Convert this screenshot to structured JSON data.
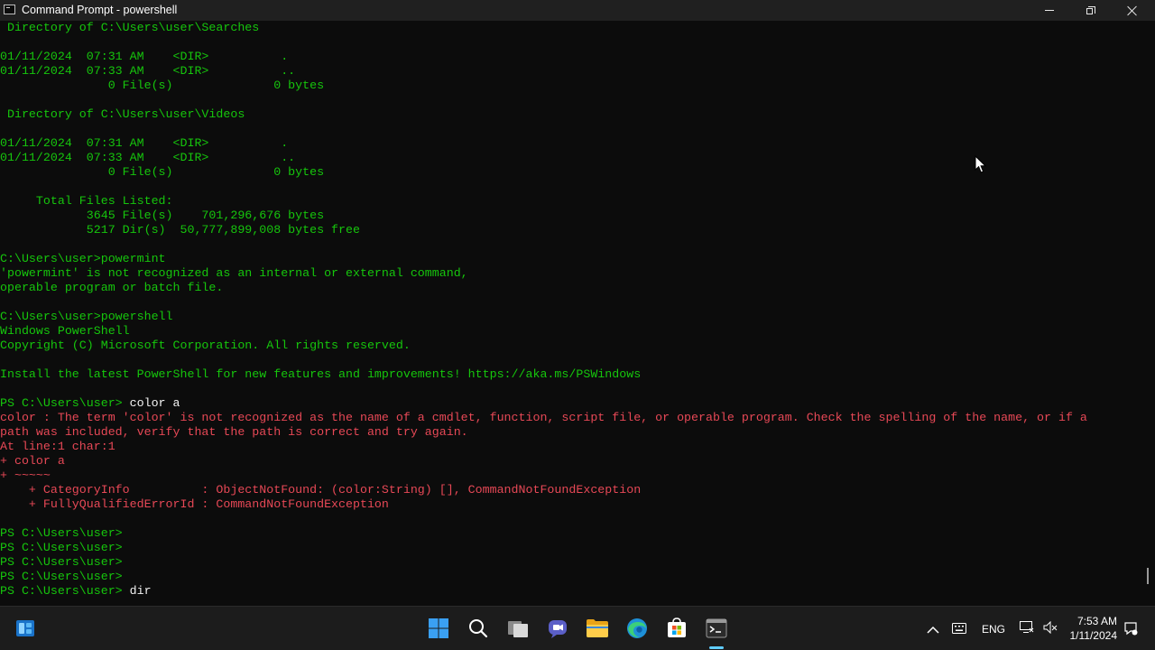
{
  "window": {
    "title": "Command Prompt - powershell",
    "controls": {
      "minimize": "minimize",
      "maximize": "restore",
      "close": "close"
    }
  },
  "terminal": {
    "lines": [
      {
        "text": " Directory of C:\\Users\\user\\Searches",
        "style": "green"
      },
      {
        "text": "",
        "style": "green"
      },
      {
        "text": "01/11/2024  07:31 AM    <DIR>          .",
        "style": "green"
      },
      {
        "text": "01/11/2024  07:33 AM    <DIR>          ..",
        "style": "green"
      },
      {
        "text": "               0 File(s)              0 bytes",
        "style": "green"
      },
      {
        "text": "",
        "style": "green"
      },
      {
        "text": " Directory of C:\\Users\\user\\Videos",
        "style": "green"
      },
      {
        "text": "",
        "style": "green"
      },
      {
        "text": "01/11/2024  07:31 AM    <DIR>          .",
        "style": "green"
      },
      {
        "text": "01/11/2024  07:33 AM    <DIR>          ..",
        "style": "green"
      },
      {
        "text": "               0 File(s)              0 bytes",
        "style": "green"
      },
      {
        "text": "",
        "style": "green"
      },
      {
        "text": "     Total Files Listed:",
        "style": "green"
      },
      {
        "text": "            3645 File(s)    701,296,676 bytes",
        "style": "green"
      },
      {
        "text": "            5217 Dir(s)  50,777,899,008 bytes free",
        "style": "green"
      },
      {
        "text": "",
        "style": "green"
      },
      {
        "text": "C:\\Users\\user>powermint",
        "style": "green"
      },
      {
        "text": "'powermint' is not recognized as an internal or external command,",
        "style": "green"
      },
      {
        "text": "operable program or batch file.",
        "style": "green"
      },
      {
        "text": "",
        "style": "green"
      },
      {
        "text": "C:\\Users\\user>powershell",
        "style": "green"
      },
      {
        "text": "Windows PowerShell",
        "style": "green"
      },
      {
        "text": "Copyright (C) Microsoft Corporation. All rights reserved.",
        "style": "green"
      },
      {
        "text": "",
        "style": "green"
      },
      {
        "text": "Install the latest PowerShell for new features and improvements! https://aka.ms/PSWindows",
        "style": "green"
      },
      {
        "text": "",
        "style": "green"
      },
      {
        "text": "PS C:\\Users\\user> ",
        "cmd": "color a",
        "style": "green"
      },
      {
        "text": "color : The term 'color' is not recognized as the name of a cmdlet, function, script file, or operable program. Check the spelling of the name, or if a",
        "style": "red"
      },
      {
        "text": "path was included, verify that the path is correct and try again.",
        "style": "red"
      },
      {
        "text": "At line:1 char:1",
        "style": "red"
      },
      {
        "text": "+ color a",
        "style": "red"
      },
      {
        "text": "+ ~~~~~",
        "style": "red"
      },
      {
        "text": "    + CategoryInfo          : ObjectNotFound: (color:String) [], CommandNotFoundException",
        "style": "red"
      },
      {
        "text": "    + FullyQualifiedErrorId : CommandNotFoundException",
        "style": "red"
      },
      {
        "text": "",
        "style": "green"
      },
      {
        "text": "PS C:\\Users\\user>",
        "style": "green"
      },
      {
        "text": "PS C:\\Users\\user>",
        "style": "green"
      },
      {
        "text": "PS C:\\Users\\user>",
        "style": "green"
      },
      {
        "text": "PS C:\\Users\\user>",
        "style": "green"
      },
      {
        "text": "PS C:\\Users\\user> ",
        "cmd": "dir",
        "style": "green"
      }
    ]
  },
  "colors": {
    "terminal_bg": "#0c0c0c",
    "green": "#16c60c",
    "red": "#e74856",
    "taskbar_bg": "#1c1c1c",
    "accent": "#60cdff"
  },
  "taskbar": {
    "items": [
      {
        "name": "start-icon"
      },
      {
        "name": "search-icon"
      },
      {
        "name": "task-view-icon"
      },
      {
        "name": "chat-icon"
      },
      {
        "name": "file-explorer-icon"
      },
      {
        "name": "edge-icon"
      },
      {
        "name": "store-icon"
      },
      {
        "name": "terminal-icon",
        "active": true
      }
    ],
    "tray": {
      "language": "ENG",
      "time": "7:53 AM",
      "date": "1/11/2024"
    }
  }
}
